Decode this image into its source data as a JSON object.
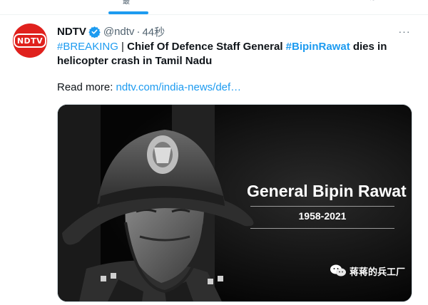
{
  "top_tabs": {
    "left_fragment": "最",
    "right_fragment": "≋"
  },
  "tweet": {
    "author": {
      "name": "NDTV",
      "handle": "@ndtv",
      "separator": "·",
      "time": "44秒",
      "avatar_text": "NDTV"
    },
    "more_label": "···",
    "body": {
      "hashtag1": "#BREAKING",
      "pipe": " | ",
      "headline_a": "Chief Of Defence Staff General ",
      "hashtag2": "#BipinRawat",
      "headline_b": " dies in",
      "line2": "helicopter crash in Tamil Nadu"
    },
    "read_more": {
      "label": "Read more: ",
      "link": "ndtv.com/india-news/def…"
    },
    "media": {
      "title": "General Bipin Rawat",
      "years": "1958-2021"
    }
  },
  "watermark": {
    "text": "蒋蒋的兵工厂"
  },
  "colors": {
    "accent": "#1d9bf0",
    "ndtv_red": "#e0211d",
    "text": "#0f1419",
    "muted": "#536471"
  }
}
